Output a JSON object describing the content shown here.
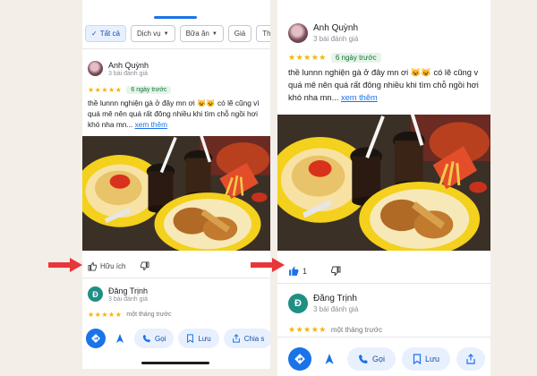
{
  "colors": {
    "accent": "#1a73e8",
    "arrow": "#e8363a",
    "star": "#f6b400",
    "badge_bg": "#e6f4ea",
    "badge_text": "#137333"
  },
  "left": {
    "filters": [
      {
        "label": "Tất cả",
        "active": true
      },
      {
        "label": "Dịch vụ"
      },
      {
        "label": "Bữa ăn"
      },
      {
        "label": "Giá"
      },
      {
        "label": "Th"
      }
    ],
    "review": {
      "author": "Anh Quỳnh",
      "count": "3 bài đánh giá",
      "stars": "★★★★★",
      "badge": "6 ngày trước",
      "text": "thề lunnn nghiện gà ở đây mn ơi 😺😺 có lẽ cũng vì quá mê nên quá rất đông nhiều khi tìm chỗ ngồi hơi khó nha mn...",
      "more": "xem thêm"
    },
    "helpful_label": "Hữu ích",
    "next_review": {
      "initial": "Đ",
      "author": "Đăng Trịnh",
      "count": "3 bài đánh giá",
      "stars": "★★★★★",
      "time": "một tháng trước"
    },
    "bottom": {
      "call": "Gọi",
      "save": "Lưu",
      "share": "Chia s"
    }
  },
  "right": {
    "review": {
      "author": "Anh Quỳnh",
      "count": "3 bài đánh giá",
      "stars": "★★★★★",
      "badge": "6 ngày trước",
      "text": "thề lunnn nghiện gà ở đây mn ơi 😺😺 có lẽ cũng v quá mê nên quá rất đông nhiều khi tìm chỗ ngồi hơi khó nha mn...",
      "more": "xem thêm"
    },
    "like_count": "1",
    "next_review": {
      "initial": "Đ",
      "author": "Đăng Trịnh",
      "count": "3 bài đánh giá",
      "stars": "★★★★★",
      "time": "một tháng trước"
    },
    "bottom": {
      "call": "Gọi",
      "save": "Lưu"
    }
  }
}
